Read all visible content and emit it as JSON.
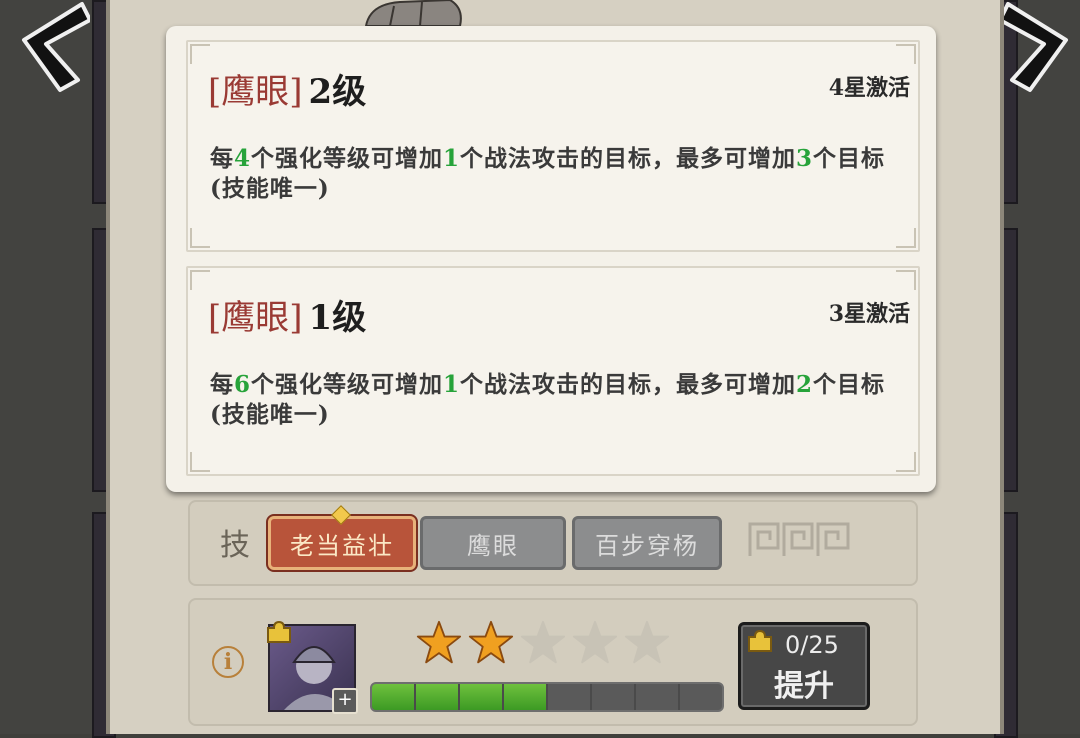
{
  "entries": [
    {
      "name": "鹰眼",
      "level": "2级",
      "activation": "4星激活",
      "desc": {
        "p1": "每",
        "n1": "4",
        "p2": "个强化等级可增加",
        "n2": "1",
        "p3": "个战法攻击的目标，最多可增加",
        "n3": "3",
        "p4": "个目标(技能唯一)"
      }
    },
    {
      "name": "鹰眼",
      "level": "1级",
      "activation": "3星激活",
      "desc": {
        "p1": "每",
        "n1": "6",
        "p2": "个强化等级可增加",
        "n2": "1",
        "p3": "个战法攻击的目标，最多可增加",
        "n3": "2",
        "p4": "个目标(技能唯一)"
      }
    }
  ],
  "skills": {
    "label": "技",
    "tabs": [
      "老当益壮",
      "鹰眼",
      "百步穿杨"
    ],
    "active_index": 0
  },
  "upgrade": {
    "info_symbol": "i",
    "stars_filled": 2,
    "stars_total": 5,
    "progress_filled_segments": 4,
    "progress_total_segments": 8,
    "count": "0/25",
    "button_label": "提升",
    "plus_symbol": "+"
  },
  "colors": {
    "bracket": "#9a3a34",
    "highlight_number": "#27a33a",
    "active_tab": "#b8543a",
    "star": "#f0a020"
  }
}
